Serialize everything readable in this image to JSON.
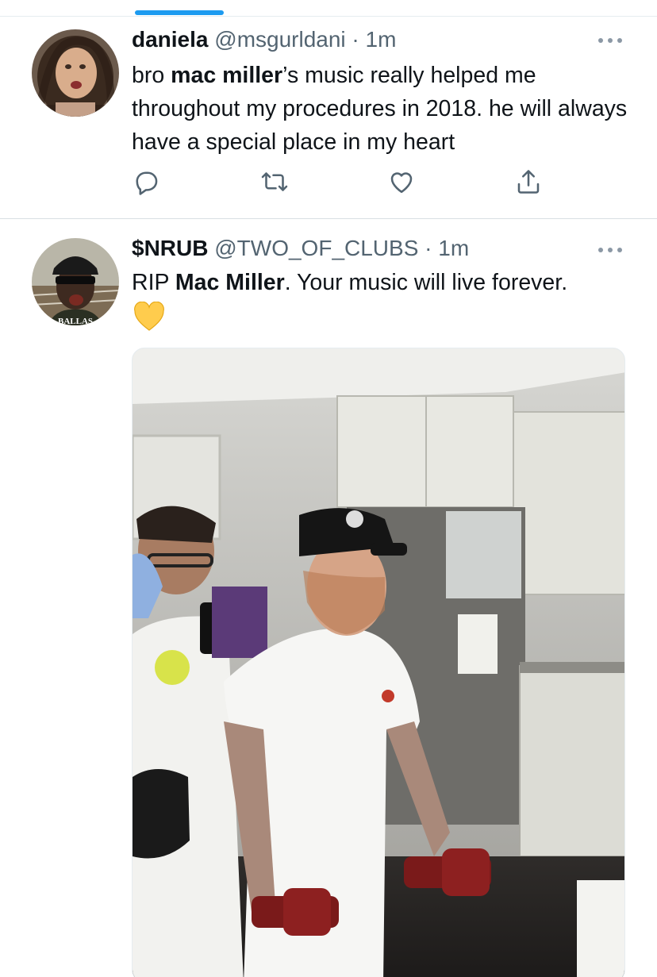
{
  "timeline": {
    "tweets": [
      {
        "display_name": "daniela",
        "handle": "@msgurldani",
        "separator": "·",
        "time": "1m",
        "text_parts": [
          "bro ",
          "mac miller",
          "’s music really helped me throughout my procedures in 2018. he will always have a special place in my heart"
        ],
        "actions": {
          "reply_icon": "reply-icon",
          "retweet_icon": "retweet-icon",
          "like_icon": "like-icon",
          "share_icon": "share-icon"
        }
      },
      {
        "display_name": "$NRUB",
        "handle": "@TWO_OF_CLUBS",
        "separator": "·",
        "time": "1m",
        "text_parts": [
          "RIP ",
          "Mac Miller",
          ". Your music will live forever."
        ],
        "emoji": "yellow-heart",
        "avatar_caption": "BALLAS",
        "media": "photo"
      }
    ]
  },
  "colors": {
    "accent": "#1d9bf0",
    "text_primary": "#0f1419",
    "text_secondary": "#536471",
    "icon": "#536471",
    "divider": "#e6ecf0"
  }
}
